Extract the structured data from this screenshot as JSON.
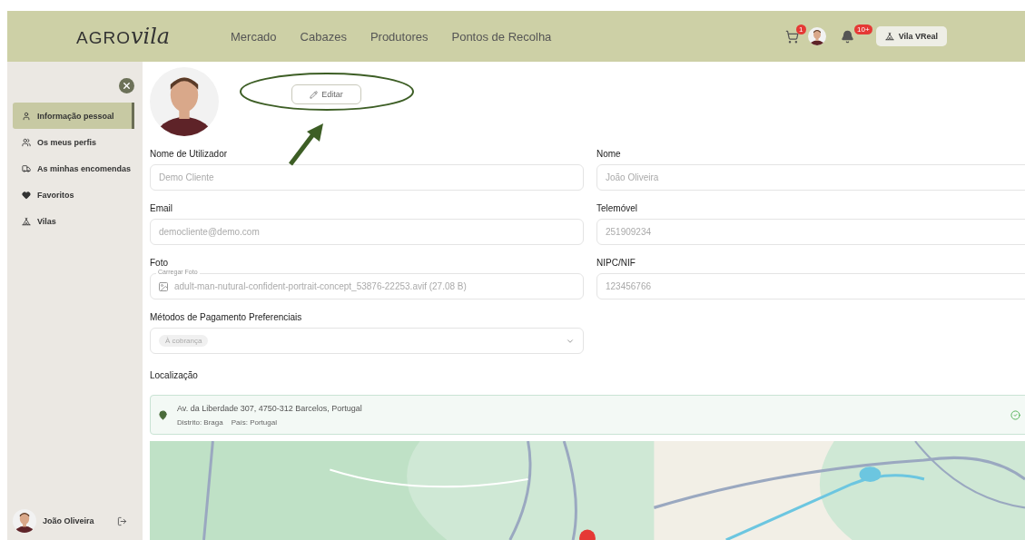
{
  "header": {
    "logo": {
      "left": "AGRO",
      "right": "vila"
    },
    "nav": [
      {
        "label": "Mercado"
      },
      {
        "label": "Cabazes"
      },
      {
        "label": "Produtores"
      },
      {
        "label": "Pontos de Recolha"
      }
    ],
    "cart_badge": "1",
    "notifications_badge": "10+",
    "vila_button": "Vila VReal"
  },
  "sidebar": {
    "items": [
      {
        "label": "Informação pessoal",
        "selected": true
      },
      {
        "label": "Os meus perfis",
        "selected": false
      },
      {
        "label": "As minhas encomendas",
        "selected": false
      },
      {
        "label": "Favoritos",
        "selected": false
      },
      {
        "label": "Vilas",
        "selected": false
      }
    ],
    "user": "João Oliveira"
  },
  "profile": {
    "edit_button": "Editar"
  },
  "form": {
    "fields": [
      {
        "label": "Nome de Utilizador",
        "value": "Demo Cliente",
        "disabled": true,
        "kind": "text"
      },
      {
        "label": "Nome",
        "value": "João Oliveira",
        "disabled": true,
        "kind": "text"
      },
      {
        "label": "Email",
        "value": "democliente@demo.com",
        "disabled": true,
        "kind": "text"
      },
      {
        "label": "Telemóvel",
        "value": "251909234",
        "disabled": true,
        "kind": "text"
      },
      {
        "label": "Foto",
        "floating_label": "Carregar Foto",
        "value": "adult-man-nutural-confident-portrait-concept_53876-22253.avif (27.08 B)",
        "disabled": true,
        "kind": "file"
      },
      {
        "label": "NIPC/NIF",
        "value": "123456766",
        "disabled": true,
        "kind": "text"
      },
      {
        "label": "Métodos de Pagamento Preferenciais",
        "chips": [
          "À cobrança"
        ],
        "disabled": true,
        "kind": "select"
      }
    ]
  },
  "location": {
    "label": "Localização",
    "address": "Av. da Liberdade 307, 4750-312 Barcelos, Portugal",
    "district": "Distrito: Braga",
    "country": "País: Portugal",
    "verified": true
  }
}
